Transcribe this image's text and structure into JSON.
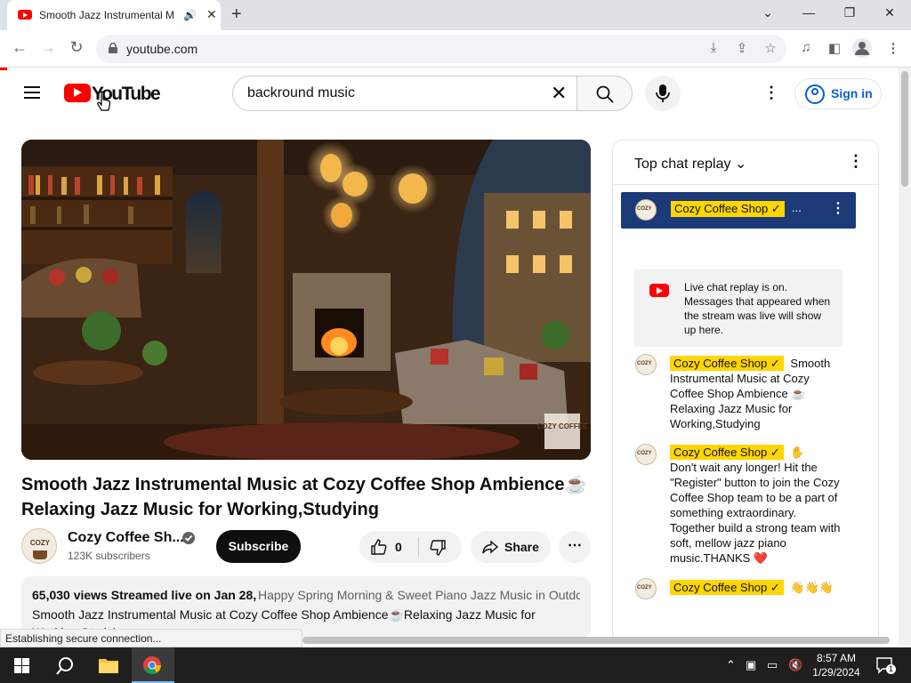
{
  "browser": {
    "tab_title": "Smooth Jazz Instrumental M",
    "url": "youtube.com"
  },
  "youtube": {
    "logo_text": "YouTube",
    "search_query": "backround music",
    "signin_label": "Sign in"
  },
  "video": {
    "title": "Smooth Jazz Instrumental Music at Cozy Coffee Shop Ambience☕ Relaxing Jazz Music for Working,Studying",
    "channel_name": "Cozy Coffee Sh...",
    "subscribers": "123K subscribers",
    "subscribe_label": "Subscribe",
    "like_count": "0",
    "share_label": "Share",
    "watermark_text": "COZY COFFEE",
    "description": {
      "meta": "65,030 views  Streamed live on Jan 28,",
      "tags": "Happy Spring Morning & Sweet Piano Jazz Music in Outdo",
      "body": "Smooth Jazz Instrumental Music at Cozy Coffee Shop Ambience☕Relaxing Jazz Music for Working,Studying"
    }
  },
  "chat": {
    "header": "Top chat replay",
    "pinned_author": "Cozy Coffee Shop ✓",
    "pinned_ellipsis": "...",
    "notice": "Live chat replay is on. Messages that appeared when the stream was live will show up here.",
    "messages": [
      {
        "author": "Cozy Coffee Shop ✓",
        "text": "Smooth Instrumental Music at Cozy Coffee Shop Ambience ☕ Relaxing Jazz Music for Working,Studying"
      },
      {
        "author": "Cozy Coffee Shop ✓",
        "emoji": "✋",
        "text": "Don't wait any longer! Hit the \"Register\" button to join the Cozy Coffee Shop team to be a part of something extraordinary. Together build a strong team with soft, mellow jazz piano music.THANKS ❤️"
      },
      {
        "author": "Cozy Coffee Shop ✓",
        "text": "👋👋👋"
      }
    ]
  },
  "status_bar": "Establishing secure connection...",
  "taskbar": {
    "time": "8:57 AM",
    "date": "1/29/2024",
    "notif_count": "1"
  },
  "colors": {
    "youtube_red": "#ff0000",
    "link_blue": "#065fd4",
    "badge_yellow": "#ffd600"
  }
}
